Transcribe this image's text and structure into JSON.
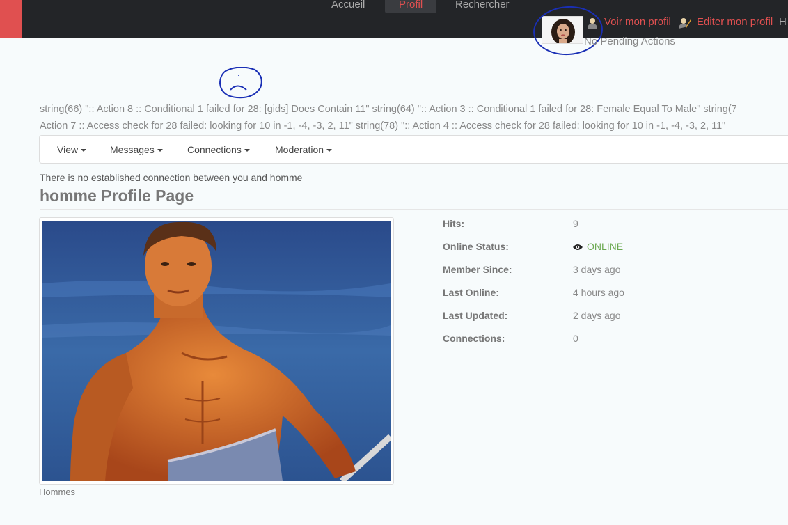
{
  "nav": {
    "items": [
      {
        "label": "Accueil"
      },
      {
        "label": "Profil"
      },
      {
        "label": "Rechercher"
      }
    ]
  },
  "user": {
    "view_profile": "Voir mon profil",
    "edit_profile": "Editer mon profil",
    "overflow": "H",
    "pending": "No Pending Actions"
  },
  "debug": {
    "line1": "string(66) \":: Action 8 :: Conditional 1 failed for 28: [gids] Does Contain 11\" string(64) \":: Action 3 :: Conditional 1 failed for 28: Female Equal To Male\" string(7",
    "line2": "Action 7 :: Access check for 28 failed: looking for 10 in -1, -4, -3, 2, 11\" string(78) \":: Action 4 :: Access check for 28 failed: looking for 10 in -1, -4, -3, 2, 11\""
  },
  "toolbar": {
    "view": "View",
    "messages": "Messages",
    "connections": "Connections",
    "moderation": "Moderation"
  },
  "connection_message": "There is no established connection between you and homme",
  "page_title": "homme Profile Page",
  "photo_caption": "Hommes",
  "stats": [
    {
      "label": "Hits:",
      "value": "9"
    },
    {
      "label": "Online Status:",
      "value": "ONLINE"
    },
    {
      "label": "Member Since:",
      "value": "3 days ago"
    },
    {
      "label": "Last Online:",
      "value": "4 hours ago"
    },
    {
      "label": "Last Updated:",
      "value": "2 days ago"
    },
    {
      "label": "Connections:",
      "value": "0"
    }
  ],
  "colors": {
    "accent": "#e05050",
    "online": "#6aa84f",
    "annotation": "#1a2fb5"
  }
}
